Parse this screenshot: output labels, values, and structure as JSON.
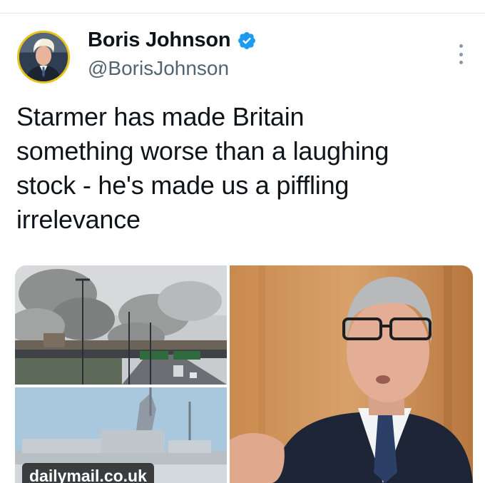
{
  "author": {
    "display_name": "Boris Johnson",
    "handle": "@BorisJohnson",
    "verified": true,
    "avatar_icon": "profile-photo"
  },
  "tweet": {
    "text": "Starmer has made Britain\nsomething worse than a laughing\nstock - he's made us a piffling\nirrelevance"
  },
  "media": {
    "source_label": "dailymail.co.uk",
    "images": [
      "smoke-over-city-photo",
      "warship-photo",
      "politician-portrait-photo"
    ]
  },
  "colors": {
    "text_primary": "#0f1419",
    "text_secondary": "#536471",
    "verified_blue": "#1d9bf0",
    "avatar_ring": "#e8c21a"
  }
}
